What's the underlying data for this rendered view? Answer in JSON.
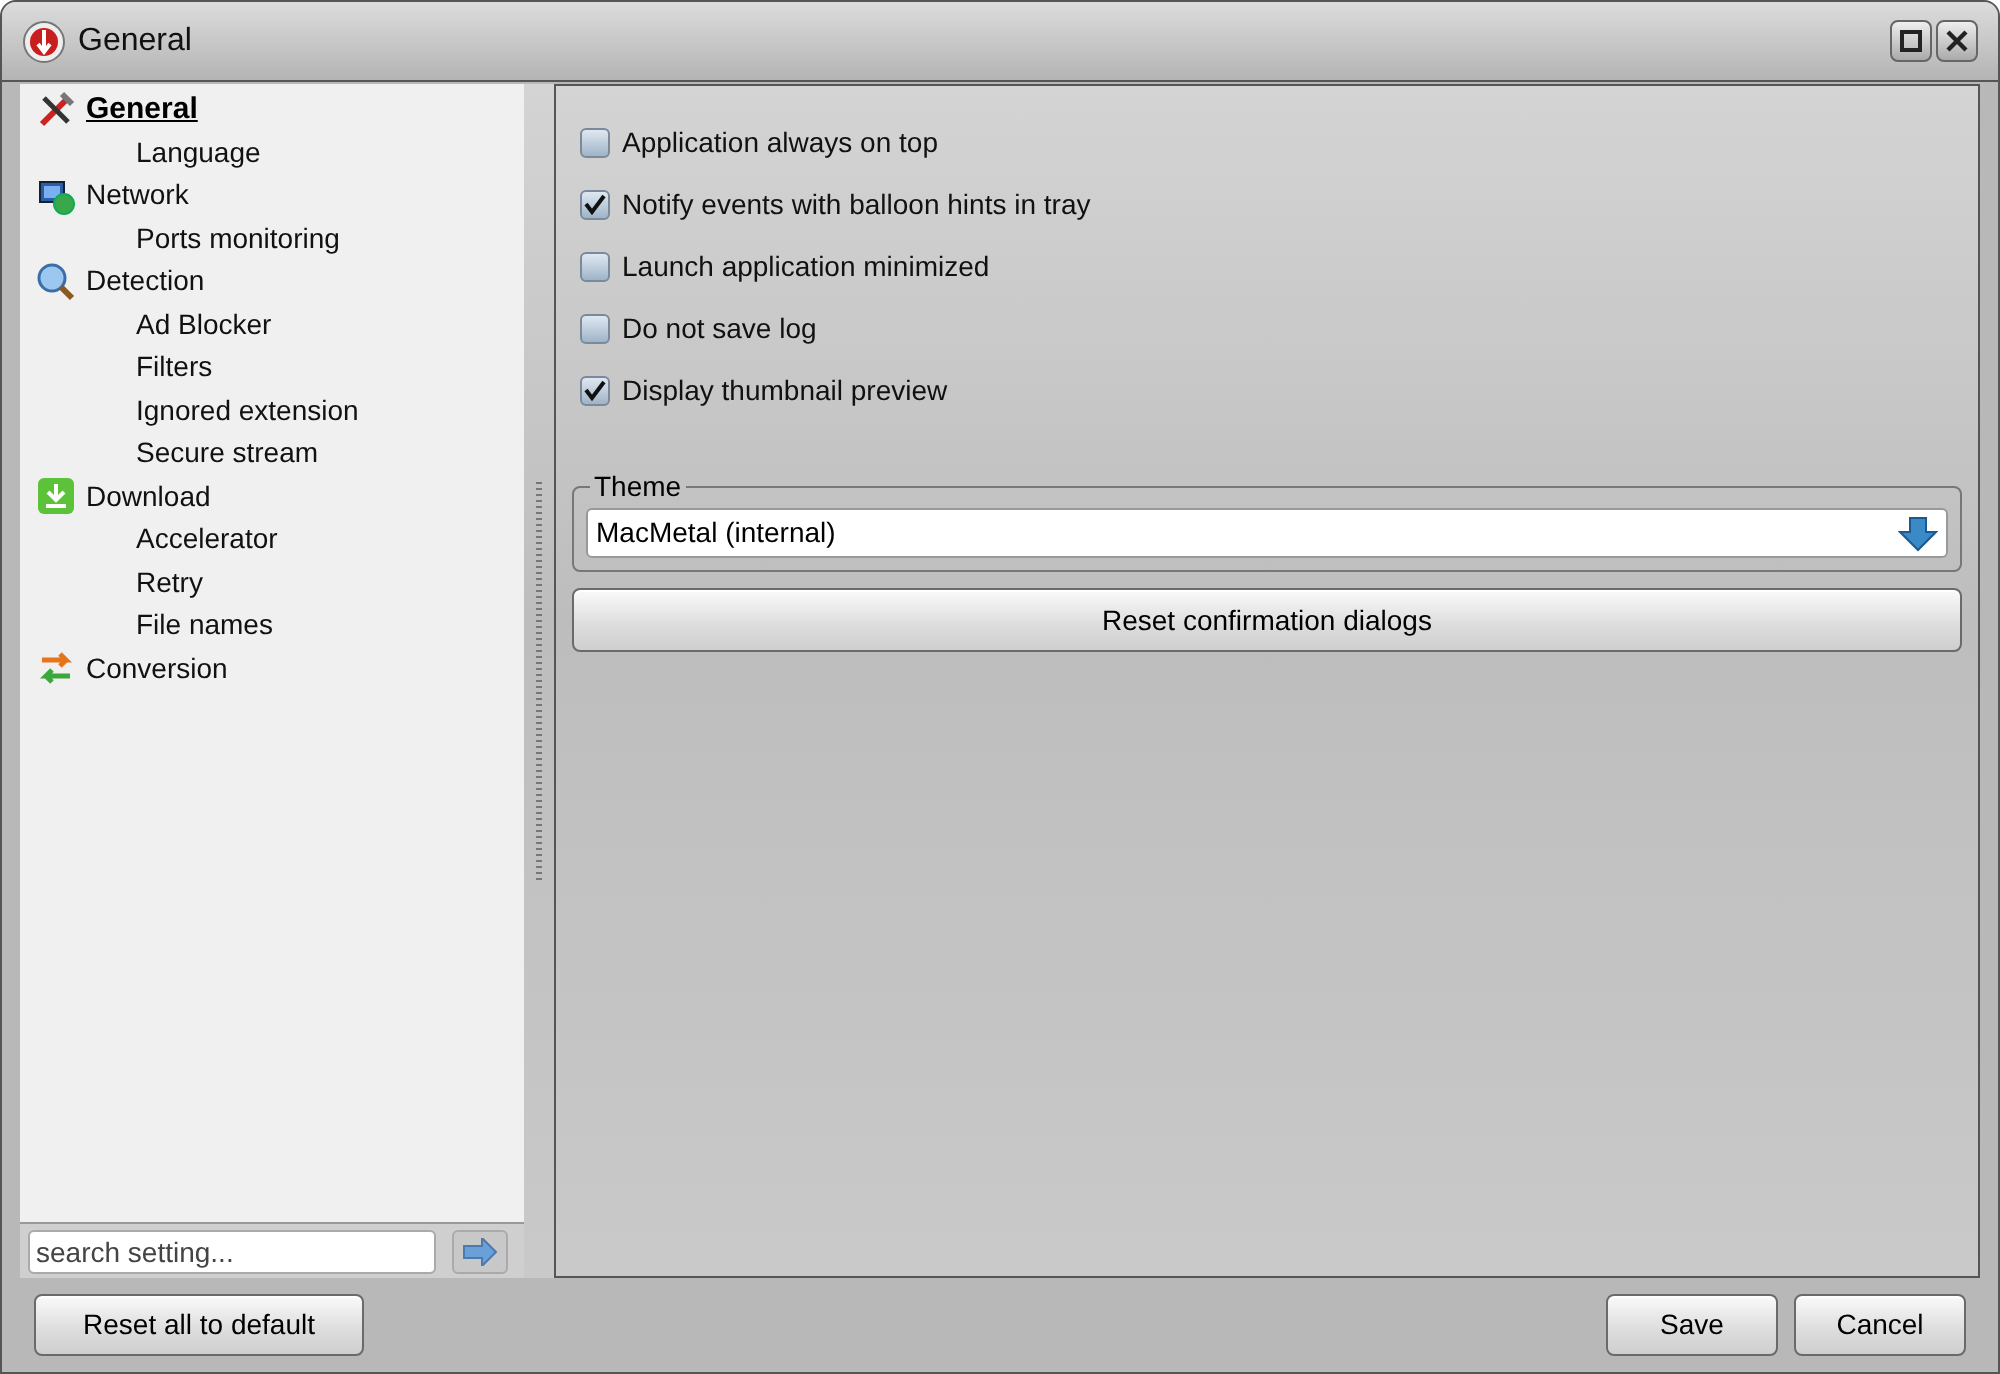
{
  "window": {
    "title": "General"
  },
  "sidebar": {
    "items": [
      {
        "label": "General",
        "kind": "tools",
        "selected": true,
        "children": [
          {
            "label": "Language",
            "selected": false
          }
        ]
      },
      {
        "label": "Network",
        "kind": "network",
        "selected": false,
        "children": [
          {
            "label": "Ports monitoring",
            "selected": false
          }
        ]
      },
      {
        "label": "Detection",
        "kind": "magnifier",
        "selected": false,
        "children": [
          {
            "label": "Ad Blocker",
            "selected": false
          },
          {
            "label": "Filters",
            "selected": false
          },
          {
            "label": "Ignored extension",
            "selected": false
          },
          {
            "label": "Secure stream",
            "selected": false
          }
        ]
      },
      {
        "label": "Download",
        "kind": "download",
        "selected": false,
        "children": [
          {
            "label": "Accelerator",
            "selected": false
          },
          {
            "label": "Retry",
            "selected": false
          },
          {
            "label": "File names",
            "selected": false
          }
        ]
      },
      {
        "label": "Conversion",
        "kind": "convert",
        "selected": false
      }
    ],
    "search": {
      "placeholder": "search setting..."
    }
  },
  "options": [
    {
      "label": "Application always on top",
      "checked": false
    },
    {
      "label": "Notify events with balloon hints in tray",
      "checked": true
    },
    {
      "label": "Launch application minimized",
      "checked": false
    },
    {
      "label": "Do not save log",
      "checked": false
    },
    {
      "label": "Display thumbnail preview",
      "checked": true
    }
  ],
  "theme": {
    "legend": "Theme",
    "value": "MacMetal (internal)"
  },
  "reset_dialogs_button": "Reset confirmation dialogs",
  "footer": {
    "reset_button": "Reset all to default",
    "save_button": "Save",
    "cancel_button": "Cancel"
  }
}
